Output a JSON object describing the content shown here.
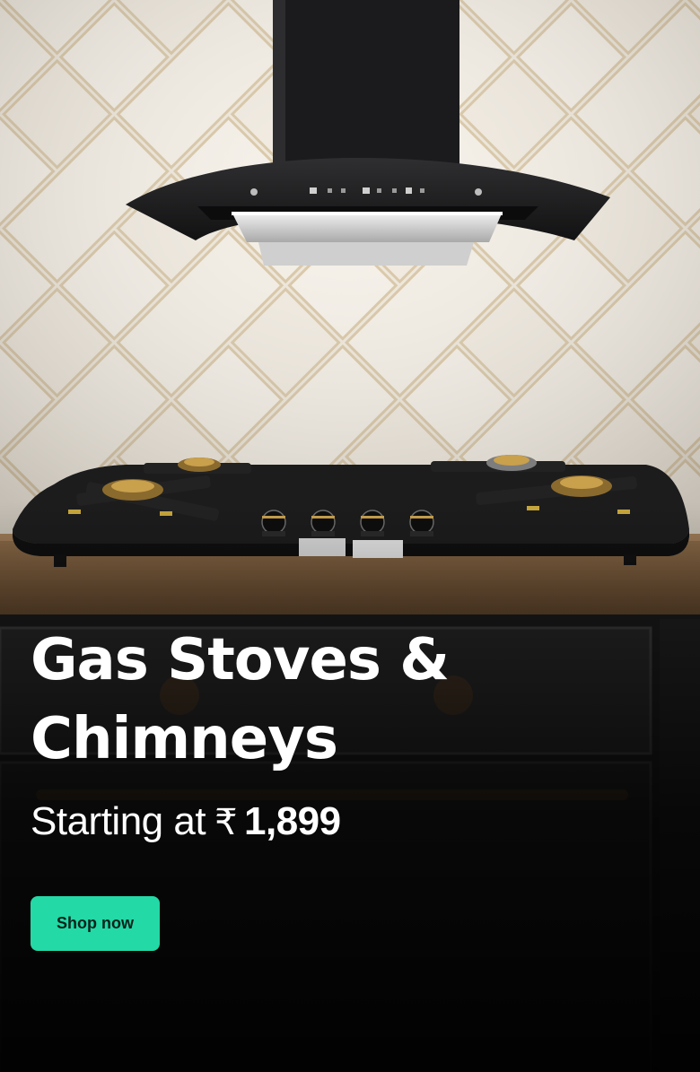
{
  "banner": {
    "headline": "Gas Stoves & Chimneys",
    "price_prefix": "Starting at",
    "currency_symbol": "₹",
    "price_value": "1,899",
    "cta_label": "Shop now"
  },
  "colors": {
    "cta_background": "#23d9a6",
    "cta_text": "#07231b",
    "headline_text": "#ffffff",
    "tile_wall": "#ece4d6",
    "countertop": "#7a5a3a",
    "cabinet": "#1b1b1b"
  },
  "icons": {
    "product_image": "chimney-and-gas-stove-photo"
  }
}
